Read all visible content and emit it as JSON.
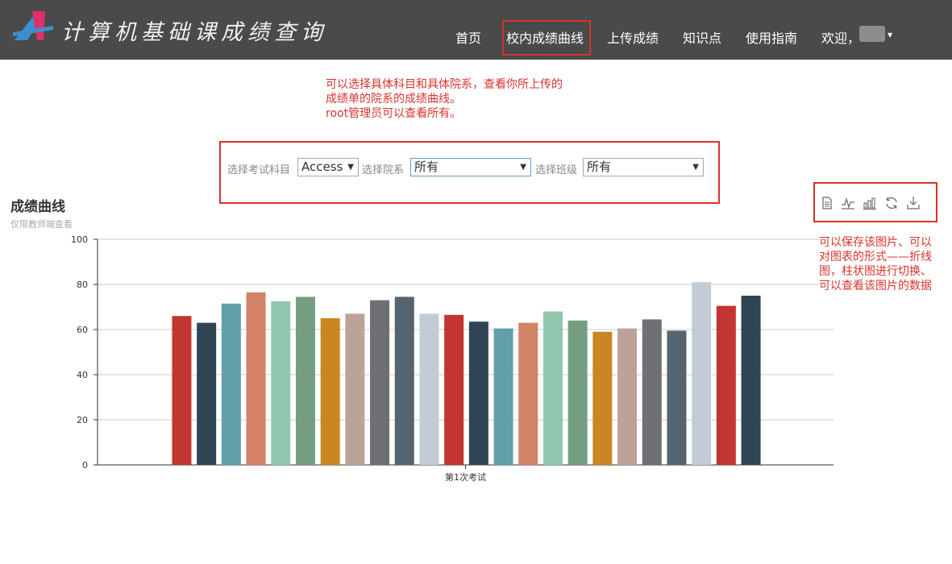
{
  "header": {
    "logo_text": "计算机基础课成绩查询",
    "nav": [
      "首页",
      "校内成绩曲线",
      "上传成绩",
      "知识点",
      "使用指南"
    ],
    "welcome": "欢迎，"
  },
  "annotations": {
    "top_note": "可以选择具体科目和具体院系，查看你所上传的\n成绩单的院系的成绩曲线。\nroot管理员可以查看所有。",
    "right_note": "可以保存该图片、可以\n对图表的形式——折线\n图，柱状图进行切换、\n可以查看该图片的数据"
  },
  "filters": {
    "subject_label": "选择考试科目",
    "subject_value": "Access",
    "department_label": "选择院系",
    "department_value": "所有",
    "class_label": "选择班级",
    "class_value": "所有"
  },
  "chart": {
    "title": "成绩曲线",
    "subtitle": "仅限教师端查看",
    "toolbox": [
      "data-view-icon",
      "line-chart-icon",
      "bar-chart-icon",
      "restore-icon",
      "save-image-icon"
    ]
  },
  "colors": {
    "header_bg": "#4a4a4a",
    "annotation_red": "#d9322d"
  },
  "chart_data": {
    "type": "bar",
    "categories": [
      "第1次考试"
    ],
    "ylim": [
      0,
      100
    ],
    "yticks": [
      0,
      20,
      40,
      60,
      80,
      100
    ],
    "grid": true,
    "series": [
      {
        "values": [
          66
        ],
        "color": "#c23531"
      },
      {
        "values": [
          63
        ],
        "color": "#2f4554"
      },
      {
        "values": [
          71.5
        ],
        "color": "#61a0a8"
      },
      {
        "values": [
          76.5
        ],
        "color": "#d48265"
      },
      {
        "values": [
          72.5
        ],
        "color": "#91c7ae"
      },
      {
        "values": [
          74.5
        ],
        "color": "#749f83"
      },
      {
        "values": [
          65
        ],
        "color": "#ca8622"
      },
      {
        "values": [
          67
        ],
        "color": "#bda29a"
      },
      {
        "values": [
          73
        ],
        "color": "#6e7074"
      },
      {
        "values": [
          74.5
        ],
        "color": "#546570"
      },
      {
        "values": [
          67
        ],
        "color": "#c4ccd3"
      },
      {
        "values": [
          66.5
        ],
        "color": "#c23531"
      },
      {
        "values": [
          63.5
        ],
        "color": "#2f4554"
      },
      {
        "values": [
          60.5
        ],
        "color": "#61a0a8"
      },
      {
        "values": [
          63
        ],
        "color": "#d48265"
      },
      {
        "values": [
          68
        ],
        "color": "#91c7ae"
      },
      {
        "values": [
          64
        ],
        "color": "#749f83"
      },
      {
        "values": [
          59
        ],
        "color": "#ca8622"
      },
      {
        "values": [
          60.5
        ],
        "color": "#bda29a"
      },
      {
        "values": [
          64.5
        ],
        "color": "#6e7074"
      },
      {
        "values": [
          59.5
        ],
        "color": "#546570"
      },
      {
        "values": [
          81
        ],
        "color": "#c4ccd3"
      },
      {
        "values": [
          70.5
        ],
        "color": "#c23531"
      },
      {
        "values": [
          75
        ],
        "color": "#2f4554"
      }
    ]
  }
}
